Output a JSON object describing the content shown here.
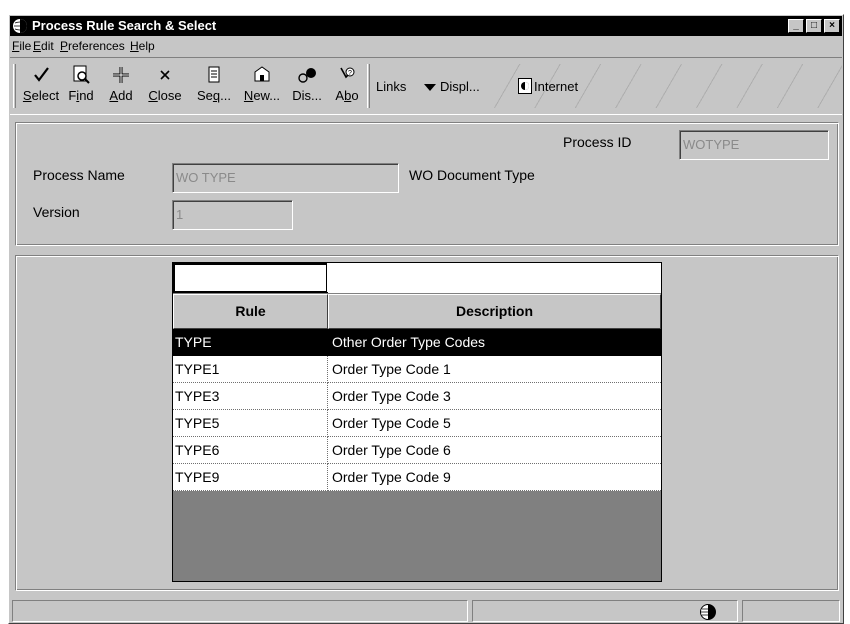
{
  "window": {
    "title": "Process Rule Search & Select",
    "controls": {
      "minimize": "_",
      "maximize": "□",
      "close": "×"
    }
  },
  "menu": {
    "items": [
      {
        "key": "F",
        "rest": "ile"
      },
      {
        "key": "E",
        "rest": "dit"
      },
      {
        "key": "P",
        "rest": "references"
      },
      {
        "key": "H",
        "rest": "elp"
      }
    ]
  },
  "toolbar": {
    "buttons": [
      {
        "icon": "checkmark-icon",
        "pre": "",
        "key": "S",
        "post": "elect"
      },
      {
        "icon": "find-icon",
        "pre": "F",
        "key": "i",
        "post": "nd"
      },
      {
        "icon": "add-icon",
        "pre": "",
        "key": "A",
        "post": "dd"
      },
      {
        "icon": "close-x-icon",
        "pre": "",
        "key": "C",
        "post": "lose"
      },
      {
        "icon": "sequence-icon",
        "pre": "Se",
        "key": "q",
        "post": "..."
      },
      {
        "icon": "new-icon",
        "pre": "",
        "key": "N",
        "post": "ew..."
      },
      {
        "icon": "display-icon",
        "pre": "Dis...",
        "key": "",
        "post": ""
      },
      {
        "icon": "about-icon",
        "pre": "A",
        "key": "b",
        "post": "o"
      }
    ],
    "links_label": "Links",
    "display_label": "Displ...",
    "internet_label": "Internet"
  },
  "header": {
    "process_id_label": "Process ID",
    "process_id_value": "WOTYPE",
    "process_name_label": "Process Name",
    "process_name_value": "WO TYPE",
    "process_name_desc": "WO Document Type",
    "version_label": "Version",
    "version_value": "1"
  },
  "grid": {
    "columns": [
      "Rule",
      "Description"
    ],
    "rows": [
      {
        "rule": "TYPE",
        "description": "Other Order Type Codes",
        "selected": true
      },
      {
        "rule": "TYPE1",
        "description": "Order Type Code 1",
        "selected": false
      },
      {
        "rule": "TYPE3",
        "description": "Order Type Code 3",
        "selected": false
      },
      {
        "rule": "TYPE5",
        "description": "Order Type Code 5",
        "selected": false
      },
      {
        "rule": "TYPE6",
        "description": "Order Type Code 6",
        "selected": false
      },
      {
        "rule": "TYPE9",
        "description": "Order Type Code 9",
        "selected": false
      }
    ]
  },
  "colors": {
    "face": "#c6c6c6",
    "title_bar": "#000000",
    "selected_row": "#000000",
    "grid_empty": "#808080"
  }
}
